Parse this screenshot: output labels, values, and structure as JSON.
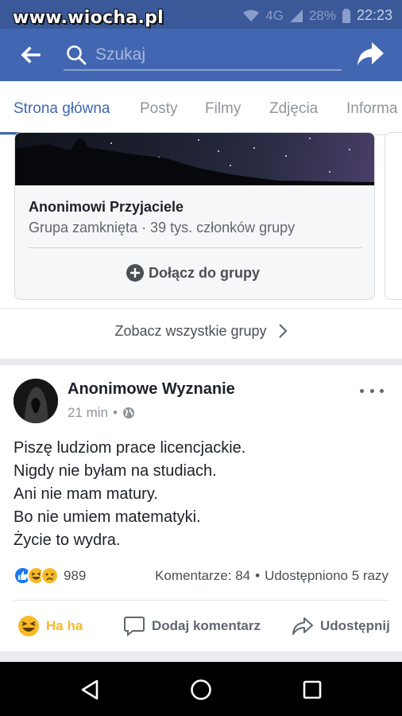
{
  "watermark": {
    "text": "www.wiocha.pl"
  },
  "status_bar": {
    "network": "4G",
    "battery": "28%",
    "time": "22:23"
  },
  "search": {
    "placeholder": "Szukaj",
    "value": ""
  },
  "tabs": [
    {
      "label": "Strona główna",
      "active": true
    },
    {
      "label": "Posty",
      "active": false
    },
    {
      "label": "Filmy",
      "active": false
    },
    {
      "label": "Zdjęcia",
      "active": false
    },
    {
      "label": "Informa",
      "active": false
    }
  ],
  "group_card": {
    "name": "Anonimowi Przyjaciele",
    "meta": "Grupa zamknięta · 39 tys. członków grupy",
    "join_label": "Dołącz do grupy"
  },
  "see_all_groups": "Zobacz wszystkie grupy",
  "post": {
    "author": "Anonimowe Wyznanie",
    "time": "21 min",
    "visibility_icon": "globe-icon",
    "lines": [
      "Piszę ludziom prace licencjackie.",
      "Nigdy nie byłam na studiach.",
      "Ani nie mam matury.",
      "Bo nie umiem matematyki.",
      "Życie to wydra."
    ],
    "reactions": [
      "like-icon",
      "haha-icon",
      "sad-icon"
    ],
    "reaction_count": "989",
    "comments": "Komentarze: 84",
    "shares": "Udostępniono 5 razy",
    "actions": {
      "haha": "Ha ha",
      "comment": "Dodaj komentarz",
      "share": "Udostępnij"
    }
  },
  "colors": {
    "brand_blue": "#4267b2",
    "status_blue": "#3b5998",
    "haha_yellow": "#f7b928",
    "like_blue": "#1877f2"
  }
}
